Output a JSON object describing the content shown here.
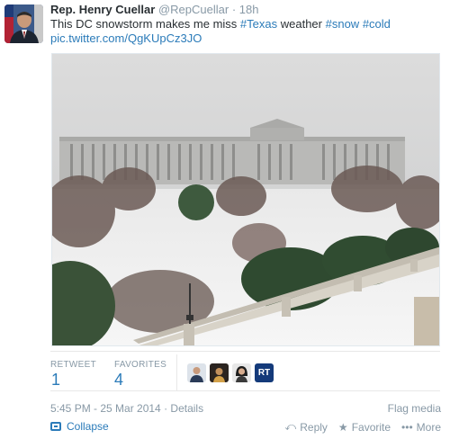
{
  "tweet": {
    "full_name": "Rep. Henry Cuellar",
    "screen_name": "@RepCuellar",
    "separator": "·",
    "time": "18h",
    "text_parts": {
      "lead": "This DC snowstorm makes me miss ",
      "tag1": "#Texas",
      "mid": " weather ",
      "tag2": "#snow",
      "space": " ",
      "tag3": "#cold"
    },
    "pic_link": "pic.twitter.com/QgKUpCz3JO"
  },
  "stats": {
    "retweets_label": "RETWEET",
    "retweets_value": "1",
    "favorites_label": "FAVORITES",
    "favorites_value": "4",
    "favoriters": [
      {
        "icon": "user-avatar-man"
      },
      {
        "icon": "user-avatar-dark"
      },
      {
        "icon": "user-avatar-woman"
      },
      {
        "icon": "rt-logo-avatar",
        "text": "RT"
      }
    ]
  },
  "meta": {
    "timestamp": "5:45 PM - 25 Mar 2014",
    "separator": "·",
    "details": "Details",
    "flag": "Flag media"
  },
  "actions": {
    "collapse": "Collapse",
    "reply": "Reply",
    "favorite": "Favorite",
    "more": "More",
    "reply_glyph": "⤺",
    "favorite_glyph": "★",
    "more_glyph": "•••"
  },
  "colors": {
    "link": "#2b7bb9",
    "muted": "#8899a6",
    "text": "#292f33"
  }
}
